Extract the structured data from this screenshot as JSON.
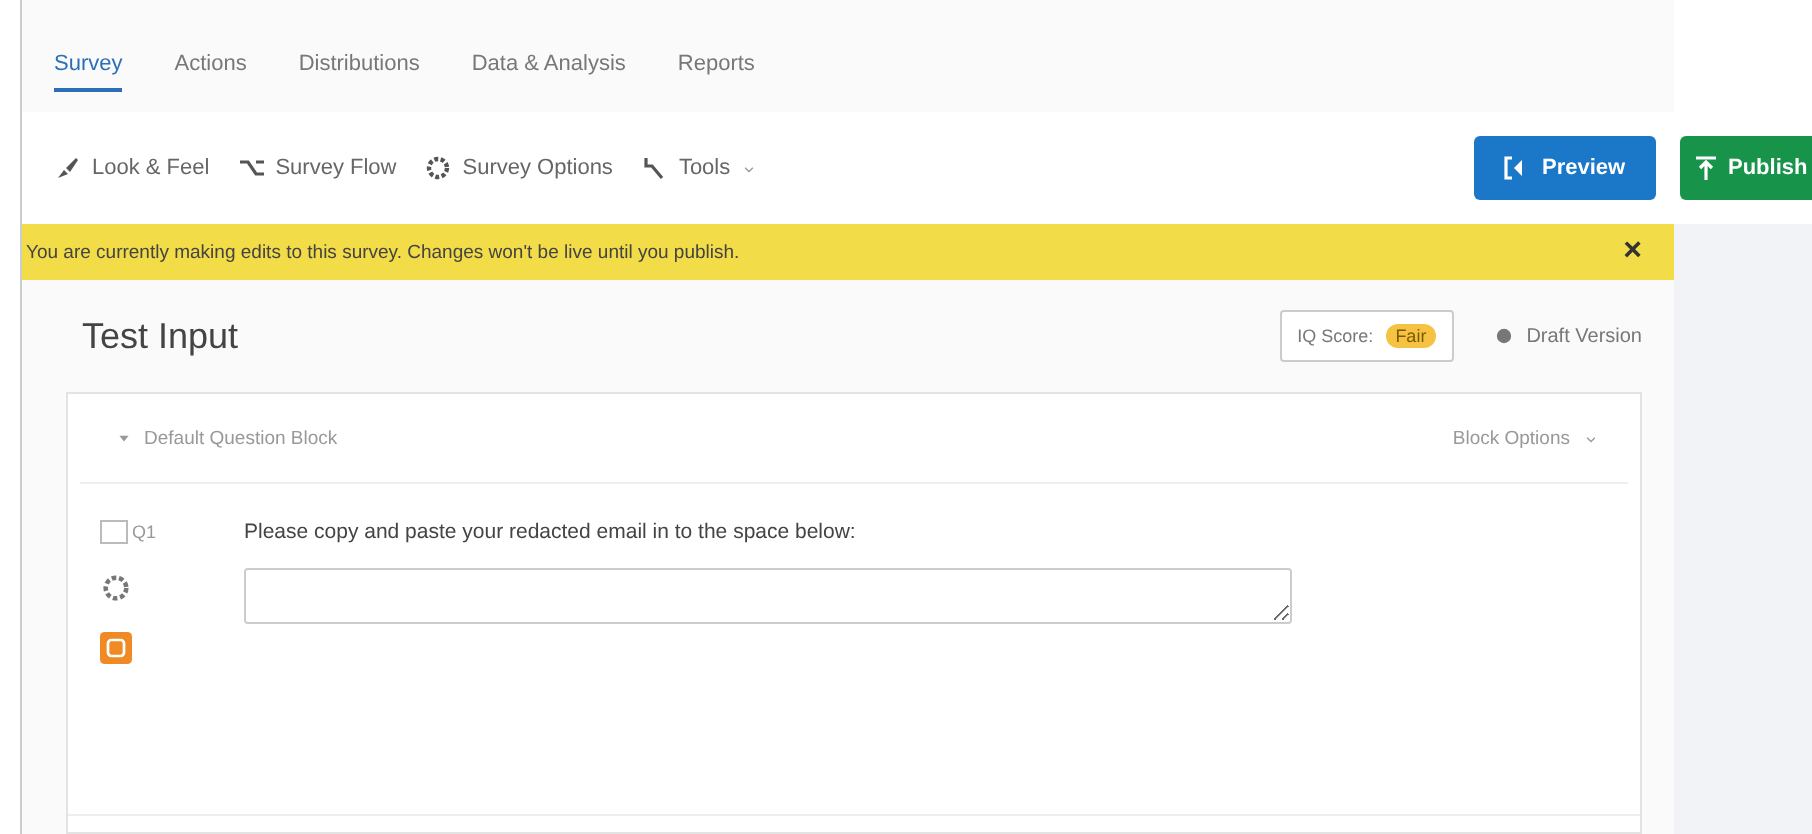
{
  "tabs": [
    {
      "label": "Survey",
      "selected": true
    },
    {
      "label": "Actions",
      "selected": false
    },
    {
      "label": "Distributions",
      "selected": false
    },
    {
      "label": "Data & Analysis",
      "selected": false
    },
    {
      "label": "Reports",
      "selected": false
    }
  ],
  "toolbar": [
    {
      "kind": "brush",
      "label": "Look & Feel"
    },
    {
      "kind": "flow",
      "label": "Survey Flow"
    },
    {
      "kind": "gear",
      "label": "Survey Options"
    },
    {
      "kind": "wrench",
      "label": "Tools",
      "dropdown": true
    }
  ],
  "buttons": [
    {
      "kind": "preview",
      "label": "Preview"
    },
    {
      "kind": "publish",
      "label": "Publish"
    }
  ],
  "banner": {
    "message": "You are currently making edits to this survey. Changes won't be live until you publish.",
    "close": "×"
  },
  "survey": {
    "title": "Test Input",
    "iq_score": {
      "label": "IQ Score:",
      "rating": "Fair"
    },
    "version": "Draft Version"
  },
  "block": {
    "name": "Default Question Block",
    "options": "Block Options",
    "expanded": true
  },
  "question": {
    "number": "Q1",
    "checked": false,
    "text": "Please copy and paste your redacted email in to the space below:"
  }
}
